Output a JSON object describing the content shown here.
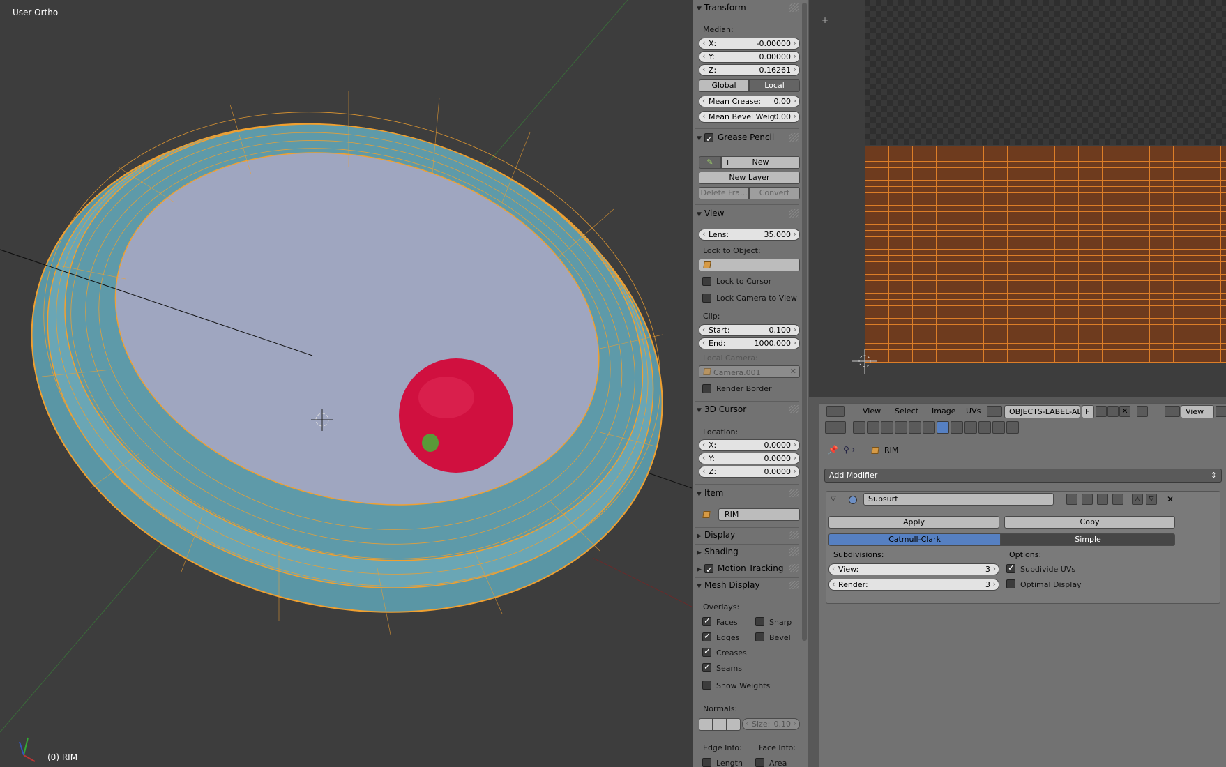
{
  "viewport": {
    "title": "User Ortho",
    "object_label": "(0) RIM"
  },
  "transform": {
    "header": "Transform",
    "median_label": "Median:",
    "x_label": "X:",
    "x": "-0.00000",
    "y_label": "Y:",
    "y": "0.00000",
    "z_label": "Z:",
    "z": "0.16261",
    "global": "Global",
    "local": "Local",
    "mean_crease_label": "Mean Crease:",
    "mean_crease": "0.00",
    "mean_bevel_label": "Mean Bevel Weig:",
    "mean_bevel": "0.00"
  },
  "grease_pencil": {
    "header": "Grease Pencil",
    "new": "New",
    "new_layer": "New Layer",
    "delete_frame": "Delete Fra...",
    "convert": "Convert"
  },
  "view": {
    "header": "View",
    "lens_label": "Lens:",
    "lens": "35.000",
    "lock_to_object": "Lock to Object:",
    "lock_to_cursor": "Lock to Cursor",
    "lock_camera": "Lock Camera to View",
    "clip": "Clip:",
    "start_label": "Start:",
    "start": "0.100",
    "end_label": "End:",
    "end": "1000.000",
    "local_camera": "Local Camera:",
    "camera": "Camera.001",
    "render_border": "Render Border"
  },
  "cursor3d": {
    "header": "3D Cursor",
    "location": "Location:",
    "x_label": "X:",
    "x": "0.0000",
    "y_label": "Y:",
    "y": "0.0000",
    "z_label": "Z:",
    "z": "0.0000"
  },
  "item": {
    "header": "Item",
    "name": "RIM"
  },
  "collapsed": {
    "display": "Display",
    "shading": "Shading",
    "motion_tracking": "Motion Tracking"
  },
  "mesh_display": {
    "header": "Mesh Display",
    "overlays": "Overlays:",
    "faces": "Faces",
    "sharp": "Sharp",
    "edges": "Edges",
    "bevel": "Bevel",
    "creases": "Creases",
    "seams": "Seams",
    "show_weights": "Show Weights",
    "normals": "Normals:",
    "size_label": "Size:",
    "size": "0.10",
    "edge_info": "Edge Info:",
    "face_info": "Face Info:",
    "length": "Length",
    "area": "Area"
  },
  "uv_header": {
    "view": "View",
    "select": "Select",
    "image": "Image",
    "uvs": "UVs",
    "image_name": "OBJECTS-LABEL-AL...",
    "f": "F",
    "view2": "View"
  },
  "properties": {
    "object": "RIM",
    "add_modifier": "Add Modifier",
    "modifier_name": "Subsurf",
    "apply": "Apply",
    "copy": "Copy",
    "catmull": "Catmull-Clark",
    "simple": "Simple",
    "subdivisions": "Subdivisions:",
    "view_label": "View:",
    "view_val": "3",
    "render_label": "Render:",
    "render_val": "3",
    "options": "Options:",
    "subdivide_uvs": "Subdivide UVs",
    "optimal_display": "Optimal Display"
  },
  "colors": {
    "mesh_fill": "#5e9aa9",
    "wire": "#f0a030",
    "sphere": "#d0103f",
    "floor": "#9fa6c0",
    "accent": "#5680c2"
  }
}
